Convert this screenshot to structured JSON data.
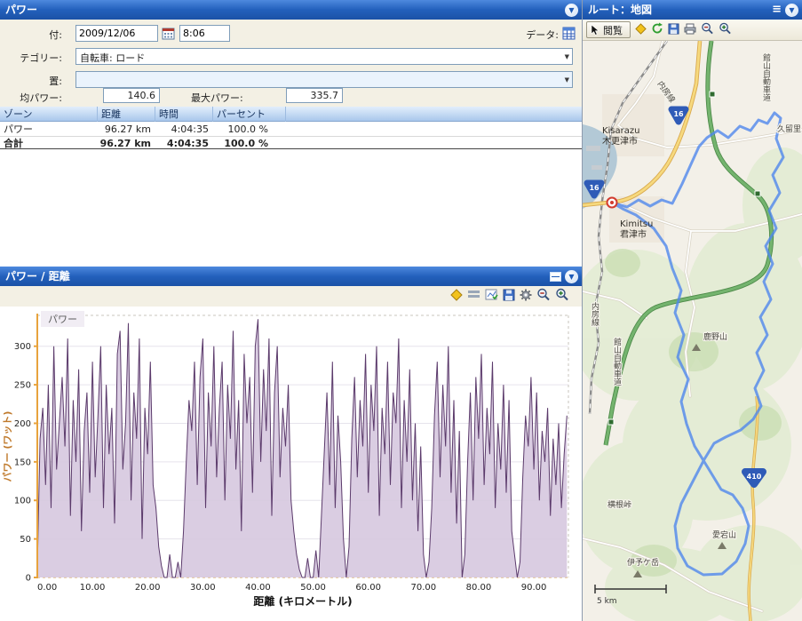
{
  "power_panel": {
    "title": "パワー",
    "date_label": "付:",
    "date_value": "2009/12/06",
    "time_value": "8:06",
    "data_label": "データ:",
    "category_label": "テゴリー:",
    "category_value": "自転車: ロード",
    "location_label": "置:",
    "location_value": "",
    "avg_power_label": "均パワー:",
    "avg_power_value": "140.6",
    "max_power_label": "最大パワー:",
    "max_power_value": "335.7",
    "zone_table": {
      "headers": [
        "ゾーン",
        "距離",
        "時間",
        "パーセント"
      ],
      "rows": [
        {
          "zone": "パワー",
          "distance": "96.27 km",
          "time": "4:04:35",
          "percent": "100.0 %"
        },
        {
          "zone": "合計",
          "distance": "96.27 km",
          "time": "4:04:35",
          "percent": "100.0 %"
        }
      ]
    }
  },
  "chart_panel": {
    "title": "パワー / 距離",
    "legend": "パワー"
  },
  "chart_data": {
    "type": "area",
    "title": "パワー / 距離",
    "xlabel": "距離 (キロメートル)",
    "ylabel": "パワー (ワット)",
    "xlim": [
      0,
      96.27
    ],
    "ylim": [
      0,
      340
    ],
    "x_step_km": 0.5,
    "x_ticks": [
      "0.00",
      "10.00",
      "20.00",
      "30.00",
      "40.00",
      "50.00",
      "60.00",
      "70.00",
      "80.00",
      "90.00"
    ],
    "y_ticks": [
      0,
      50,
      100,
      150,
      200,
      250,
      300
    ],
    "grid": "horizontal",
    "legend_position": "top-left",
    "line_color": "#5B3A6B",
    "fill_color": "#D6C8DF",
    "axis_color": "#E8A33D",
    "series": [
      {
        "name": "パワー",
        "values": [
          10,
          180,
          220,
          120,
          250,
          90,
          300,
          140,
          200,
          260,
          170,
          310,
          80,
          230,
          150,
          270,
          60,
          190,
          240,
          110,
          280,
          130,
          210,
          300,
          90,
          250,
          160,
          220,
          70,
          290,
          320,
          140,
          200,
          330,
          100,
          240,
          180,
          310,
          50,
          220,
          160,
          280,
          120,
          90,
          40,
          15,
          0,
          0,
          30,
          0,
          0,
          20,
          0,
          60,
          150,
          230,
          190,
          280,
          120,
          260,
          310,
          90,
          240,
          170,
          300,
          130,
          220,
          280,
          100,
          250,
          180,
          320,
          140,
          230,
          60,
          290,
          200,
          260,
          110,
          300,
          335,
          150,
          270,
          190,
          310,
          80,
          240,
          300,
          130,
          220,
          170,
          250,
          100,
          60,
          30,
          10,
          0,
          0,
          25,
          0,
          0,
          35,
          0,
          80,
          160,
          240,
          120,
          280,
          90,
          210,
          150,
          50,
          0,
          40,
          180,
          260,
          130,
          230,
          170,
          290,
          110,
          250,
          190,
          300,
          80,
          220,
          160,
          280,
          120,
          240,
          200,
          310,
          90,
          230,
          150,
          270,
          100,
          200,
          60,
          170,
          30,
          0,
          20,
          90,
          210,
          280,
          130,
          250,
          170,
          300,
          110,
          230,
          70,
          190,
          0,
          30,
          150,
          240,
          100,
          260,
          180,
          290,
          120,
          220,
          160,
          280,
          90,
          200,
          140,
          250,
          110,
          230,
          60,
          30,
          0,
          20,
          130,
          210,
          170,
          260,
          140,
          240,
          100,
          190,
          150,
          220,
          80,
          180,
          120,
          200,
          90,
          160,
          210
        ]
      }
    ]
  },
  "map_panel": {
    "title": "ルート：地図",
    "browse_button": "閲覧",
    "scale_label": "5 km",
    "labels": {
      "uchibo_line_top": "内房線",
      "uchibo_line_left": "内房線",
      "tateyama_expwy_top": "館山自動車道",
      "tateyama_expwy_left": "館山自動車道",
      "kisarazu_en": "Kisarazu",
      "kisarazu_jp": "木更津市",
      "kimitsu_en": "Kimitsu",
      "kimitsu_jp": "君津市",
      "kururi": "久留里",
      "kanozan": "鹿野山",
      "yokone_pass": "横根峠",
      "atagoyama": "愛宕山",
      "iyogatake": "伊予ケ岳",
      "route16": "16",
      "route410": "410"
    }
  }
}
